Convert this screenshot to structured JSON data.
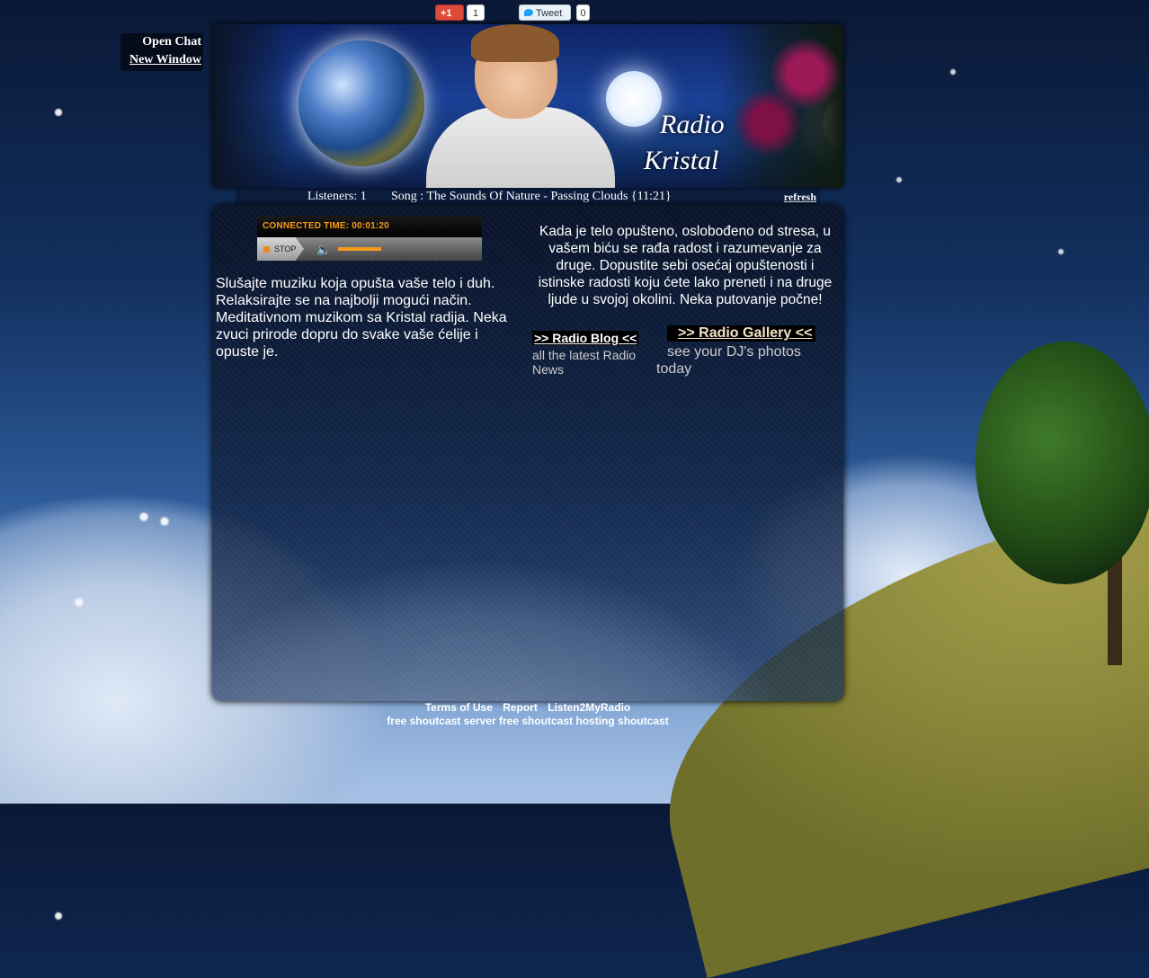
{
  "social": {
    "gplus_label": "+1",
    "gplus_count": "1",
    "tweet_label": "Tweet",
    "tweet_count": "0"
  },
  "chat": {
    "open_chat": "Open Chat",
    "new_window": "New Window"
  },
  "banner": {
    "title_line1": "Radio",
    "title_line2": "Kristal"
  },
  "now_playing": {
    "listeners": "Listeners: 1",
    "song": "Song :  The Sounds Of Nature - Passing Clouds {11:21}",
    "refresh": "refresh"
  },
  "player": {
    "connected_time": "CONNECTED TIME:  00:01:20",
    "stop": "STOP",
    "volume": 0.5
  },
  "main": {
    "left_text": "Slušajte muziku koja opušta vaše telo i duh. Relaksirajte se na najbolji mogući način. Meditativnom muzikom sa Kristal radija. Neka zvuci prirode dopru do svake vaše ćelije i opuste je.",
    "right_text": "Kada je telo opušteno, oslobođeno od stresa, u vašem biću se rađa radost i razumevanje za druge. Dopustite sebi osećaj opuštenosti i istinske radosti koju ćete lako preneti i na druge ljude u svojoj okolini. Neka putovanje počne!",
    "blog_link": ">> Radio Blog <<",
    "blog_sub": "all the latest Radio News",
    "gallery_link": ">> Radio Gallery <<",
    "gallery_sub": "see your DJ's photos",
    "gallery_sub2": "today"
  },
  "footer": {
    "terms": "Terms of Use",
    "report": "Report",
    "listen": "Listen2MyRadio",
    "line2": "free shoutcast server  free shoutcast hosting  shoutcast"
  },
  "colors": {
    "accent_orange": "#f59b1c",
    "gallery_link": "#f2e3c2"
  }
}
